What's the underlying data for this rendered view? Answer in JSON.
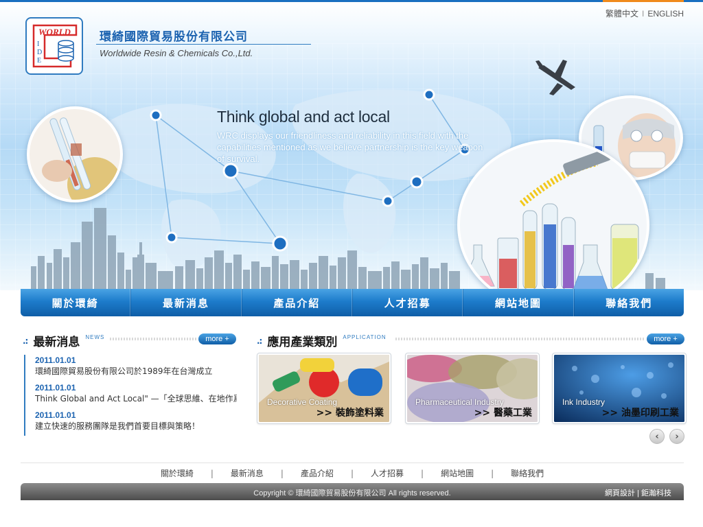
{
  "language": {
    "traditional_chinese": "繁體中文",
    "separator": "I",
    "english": "ENGLISH"
  },
  "logo": {
    "word_text": "WORLD",
    "letters": [
      "I",
      "D",
      "E"
    ]
  },
  "company": {
    "name_cn": "環綺國際貿易股份有限公司",
    "name_en": "Worldwide Resin & Chemicals Co.,Ltd."
  },
  "hero": {
    "headline": "Think global and act local",
    "tagline": "WRC displays our friendliness and reliability in this field with the capabilities mentioned as we believe partnership is the key weapon of survival."
  },
  "nav": {
    "items": [
      "關於環綺",
      "最新消息",
      "產品介紹",
      "人才招募",
      "網站地圖",
      "聯絡我們"
    ]
  },
  "news": {
    "title": "最新消息",
    "title_en": "NEWS",
    "more": "more +",
    "items": [
      {
        "date": "2011.01.01",
        "text": "環綺國際貿易股份有限公司於1989年在台灣成立"
      },
      {
        "date": "2011.01.01",
        "text": "Think Global and Act Local\" —「全球思維、在地作爲」"
      },
      {
        "date": "2011.01.01",
        "text": "建立快速的服務團隊是我們首要目標與策略！"
      }
    ]
  },
  "applications": {
    "title": "應用產業類別",
    "title_en": "APPLICATION",
    "more": "more +",
    "cards": [
      {
        "en": "Decorative Coating",
        "cn": ">> 裝飾塗料業"
      },
      {
        "en": "Pharmaceutical Industry",
        "cn": ">> 醫藥工業"
      },
      {
        "en": "Ink Industry",
        "cn": ">> 油墨印刷工業"
      }
    ],
    "prev": "‹",
    "next": "›"
  },
  "footer": {
    "links": [
      "關於環綺",
      "最新消息",
      "產品介紹",
      "人才招募",
      "網站地圖",
      "聯絡我們"
    ],
    "separator": "|",
    "copyright": "Copyright ©  環綺國際貿易股份有限公司  All rights reserved.",
    "credit_1": "網頁設計",
    "credit_sep": "|",
    "credit_2": "鉅瀚科技"
  }
}
